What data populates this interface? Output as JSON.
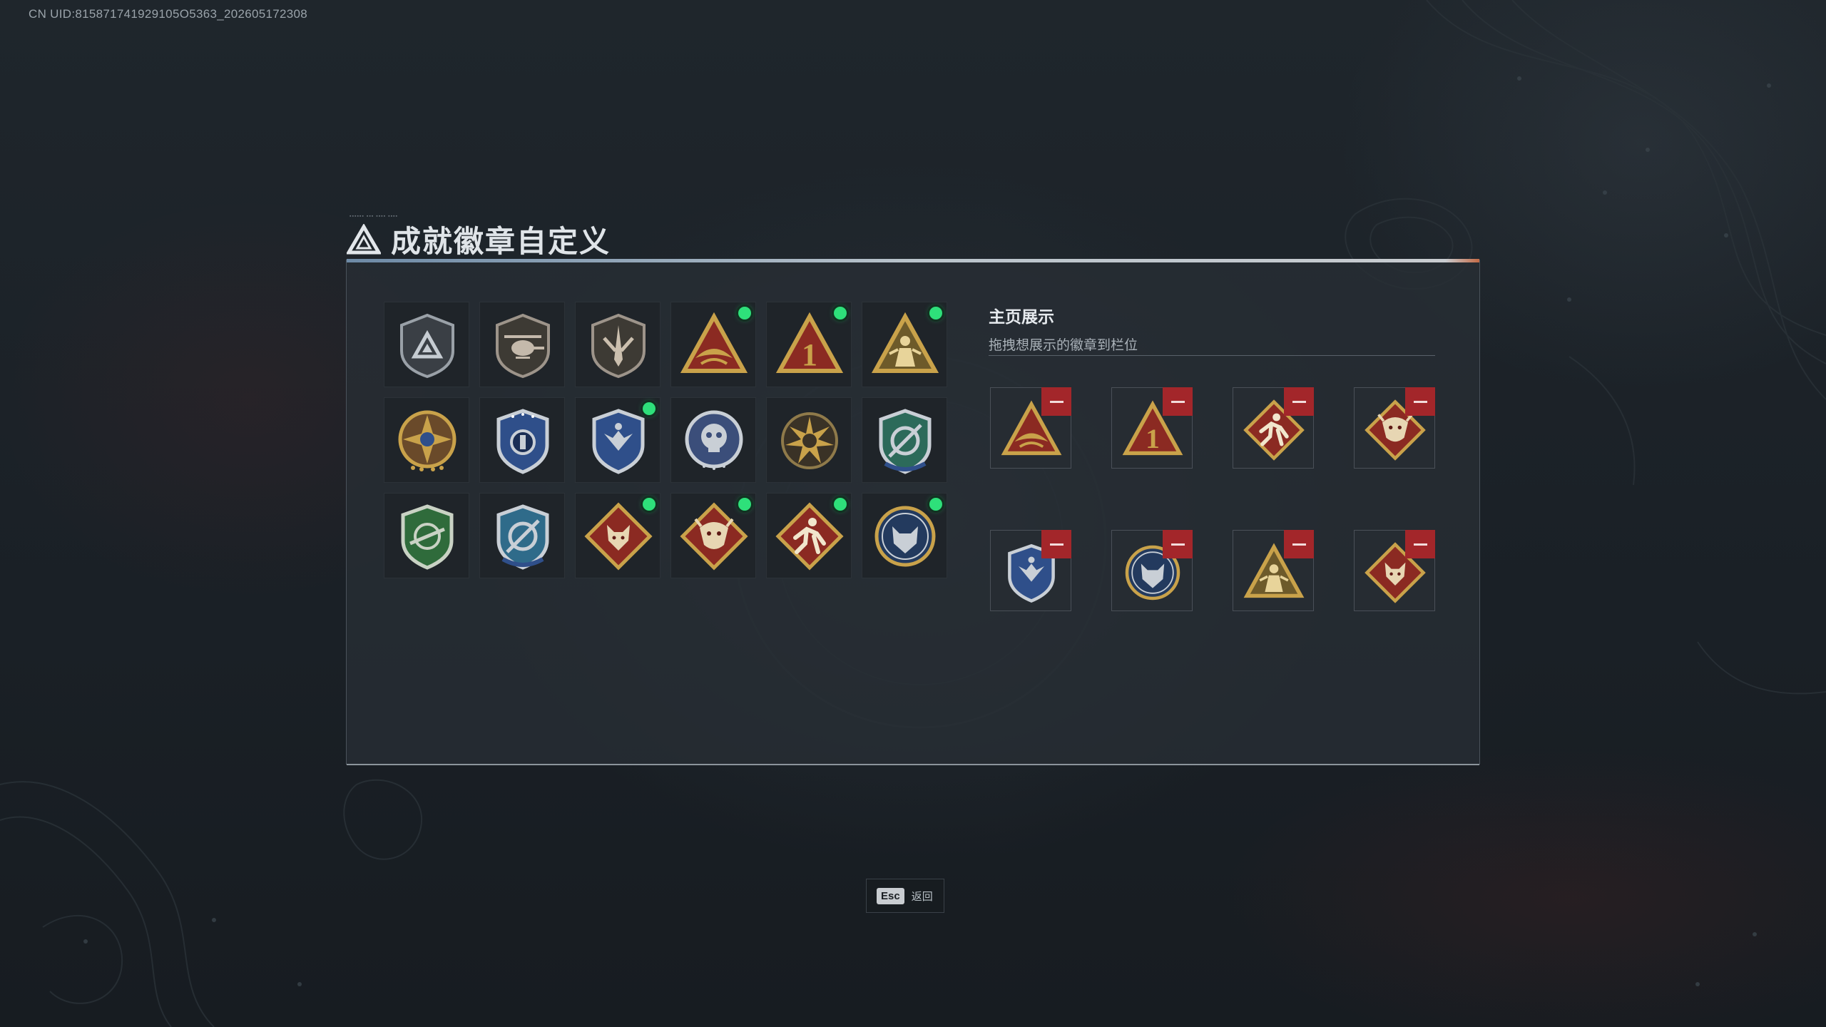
{
  "uid_text": "CN UID:815871741929105O5363_202605172308",
  "page_title": "成就徽章自定义",
  "showcase": {
    "title": "主页展示",
    "subtitle": "拖拽想展示的徽章到栏位"
  },
  "esc_button": {
    "key": "Esc",
    "label": "返回"
  },
  "badges": [
    {
      "icon": "triangle-shield-badge",
      "new": false
    },
    {
      "icon": "helicopter-shield-badge",
      "new": false
    },
    {
      "icon": "sword-shield-badge",
      "new": false
    },
    {
      "icon": "gold-wave-triangle-badge",
      "new": true
    },
    {
      "icon": "number-one-triangle-badge",
      "new": true
    },
    {
      "icon": "soldier-triangle-badge",
      "new": true
    },
    {
      "icon": "compass-star-medal-badge",
      "new": false
    },
    {
      "icon": "blue-shield-emblem-badge",
      "new": false
    },
    {
      "icon": "blue-eagle-shield-badge",
      "new": true
    },
    {
      "icon": "silver-skull-medal-badge",
      "new": false
    },
    {
      "icon": "gold-sun-medal-badge",
      "new": false
    },
    {
      "icon": "blue-green-crosshair-badge",
      "new": false
    },
    {
      "icon": "green-rifle-shield-badge",
      "new": false
    },
    {
      "icon": "blue-crosshair-shield-badge",
      "new": false
    },
    {
      "icon": "red-wolf-diamond-badge",
      "new": true
    },
    {
      "icon": "red-dragon-diamond-badge",
      "new": true
    },
    {
      "icon": "red-runner-diamond-badge",
      "new": true
    },
    {
      "icon": "blue-wolf-medal-badge",
      "new": true
    }
  ],
  "slots": [
    {
      "icon": "gold-wave-triangle-badge"
    },
    {
      "icon": "number-one-triangle-badge"
    },
    {
      "icon": "red-runner-diamond-badge"
    },
    {
      "icon": "red-dragon-diamond-badge"
    },
    {
      "icon": "blue-eagle-shield-badge"
    },
    {
      "icon": "blue-wolf-medal-badge"
    },
    {
      "icon": "soldier-triangle-badge"
    },
    {
      "icon": "red-wolf-diamond-badge"
    }
  ],
  "colors": {
    "new_dot": "#2ee07a",
    "remove_button": "#a3262a",
    "gold": "#c9a24a",
    "crimson": "#8b2a22"
  }
}
